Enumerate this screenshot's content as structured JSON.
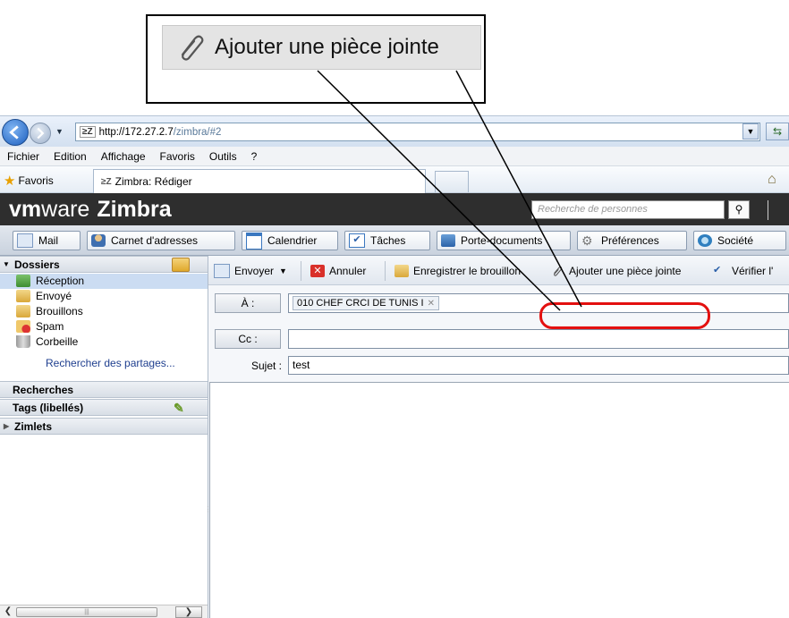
{
  "callout": {
    "label": "Ajouter une pièce jointe",
    "icon": "paperclip-icon"
  },
  "browser": {
    "url_host": "http://172.27.2.7",
    "url_path": "/zimbra/#2",
    "menu": [
      "Fichier",
      "Edition",
      "Affichage",
      "Favoris",
      "Outils",
      "?"
    ],
    "favorites_label": "Favoris",
    "active_tab": "Zimbra: Rédiger"
  },
  "header": {
    "logo_vm": "vm",
    "logo_ware": "ware",
    "logo_product": "Zimbra",
    "search_placeholder": "Recherche de personnes"
  },
  "app_tabs": [
    {
      "label": "Mail",
      "icon": "mail-icon"
    },
    {
      "label": "Carnet d'adresses",
      "icon": "address-book-icon"
    },
    {
      "label": "Calendrier",
      "icon": "calendar-icon"
    },
    {
      "label": "Tâches",
      "icon": "tasks-icon"
    },
    {
      "label": "Porte-documents",
      "icon": "briefcase-icon"
    },
    {
      "label": "Préférences",
      "icon": "gear-icon"
    },
    {
      "label": "Société",
      "icon": "globe-icon"
    }
  ],
  "sidebar": {
    "folders_header": "Dossiers",
    "folders": [
      {
        "label": "Réception",
        "icon": "inbox-icon",
        "selected": true
      },
      {
        "label": "Envoyé",
        "icon": "sent-icon"
      },
      {
        "label": "Brouillons",
        "icon": "drafts-icon"
      },
      {
        "label": "Spam",
        "icon": "spam-icon"
      },
      {
        "label": "Corbeille",
        "icon": "trash-icon"
      }
    ],
    "find_shares": "Rechercher des partages...",
    "searches_header": "Recherches",
    "tags_header": "Tags (libellés)",
    "zimlets_header": "Zimlets"
  },
  "toolbar": {
    "send": "Envoyer",
    "cancel": "Annuler",
    "save_draft": "Enregistrer le brouillon",
    "attach": "Ajouter une pièce jointe",
    "spellcheck": "Vérifier l'"
  },
  "compose": {
    "to_label": "À :",
    "to_recipient": "010 CHEF CRCI DE TUNIS I",
    "cc_label": "Cc :",
    "cc_value": "",
    "subject_label": "Sujet :",
    "subject_value": "test"
  },
  "colors": {
    "highlight": "#e3100f",
    "header_bg": "#2e2e2e",
    "selected_folder": "#cbdcf2"
  }
}
